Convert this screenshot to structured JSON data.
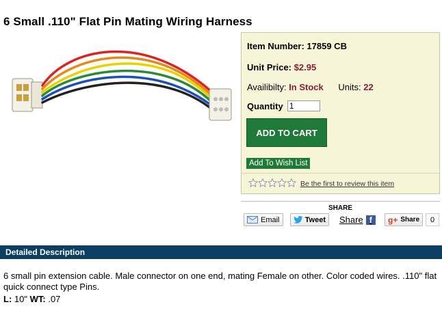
{
  "product": {
    "title": "6 Small .110\" Flat Pin Mating Wiring Harness",
    "item_number_label": "Item Number:",
    "item_number": "17859 CB",
    "unit_price_label": "Unit Price:",
    "unit_price": "$2.95",
    "availability_label": "Availibilty:",
    "availability": "In Stock",
    "units_label": "Units:",
    "units": "22",
    "quantity_label": "Quantity",
    "quantity_value": "1",
    "add_to_cart": "ADD TO CART",
    "wish_list": "Add To Wish List",
    "review_link": "Be the first to review this item",
    "rating_stars": 0
  },
  "share": {
    "title": "SHARE",
    "email": "Email",
    "tweet": "Tweet",
    "share_fb": "Share",
    "fb_glyph": "f",
    "gplus_glyph": "g+",
    "gplus": "Share",
    "gplus_count": "0"
  },
  "description": {
    "header": "Detailed Description",
    "text": "6 small pin extension cable. Male connector on one end, mating Female on other. Color coded wires. .110\" flat quick connect type Pins.",
    "length_label": "L:",
    "length_value": "10\"",
    "weight_label": "WT:",
    "weight_value": ".07"
  },
  "colors": {
    "accent_green": "#1f7a3a",
    "price_red": "#8b1d3b",
    "header_navy": "#0b3e63",
    "panel_bg": "#f7f5d8"
  }
}
